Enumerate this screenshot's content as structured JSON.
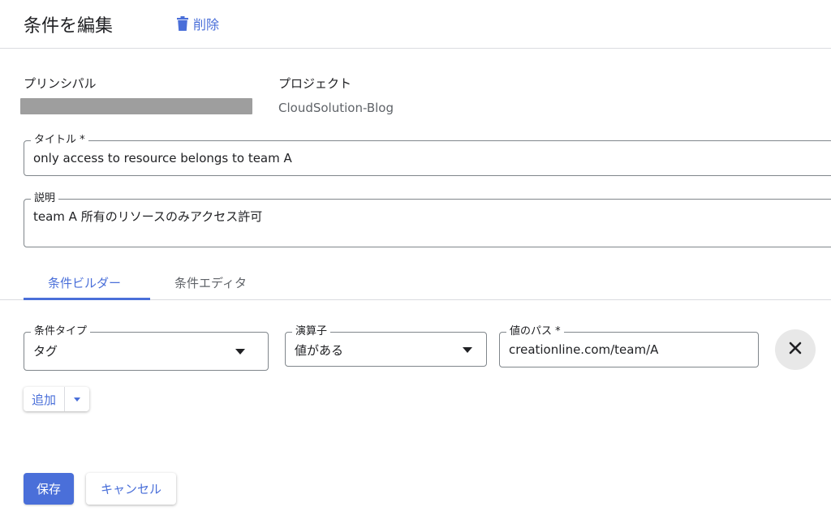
{
  "header": {
    "title": "条件を編集",
    "delete_label": "削除"
  },
  "principal": {
    "label": "プリンシパル"
  },
  "project": {
    "label": "プロジェクト",
    "value": "CloudSolution-Blog"
  },
  "title_field": {
    "label": "タイトル *",
    "value": "only access to resource belongs to team A"
  },
  "description_field": {
    "label": "説明",
    "value": "team A 所有のリソースのみアクセス許可"
  },
  "tabs": [
    {
      "label": "条件ビルダー",
      "active": true
    },
    {
      "label": "条件エディタ",
      "active": false
    }
  ],
  "condition": {
    "type_label": "条件タイプ",
    "type_value": "タグ",
    "operator_label": "演算子",
    "operator_value": "値がある",
    "path_label": "値のパス *",
    "path_value": "creationline.com/team/A"
  },
  "add_button": {
    "label": "追加"
  },
  "footer": {
    "save_label": "保存",
    "cancel_label": "キャンセル"
  },
  "colors": {
    "accent": "#4a6fd9",
    "border": "#80868b",
    "divider": "#dadce0"
  }
}
